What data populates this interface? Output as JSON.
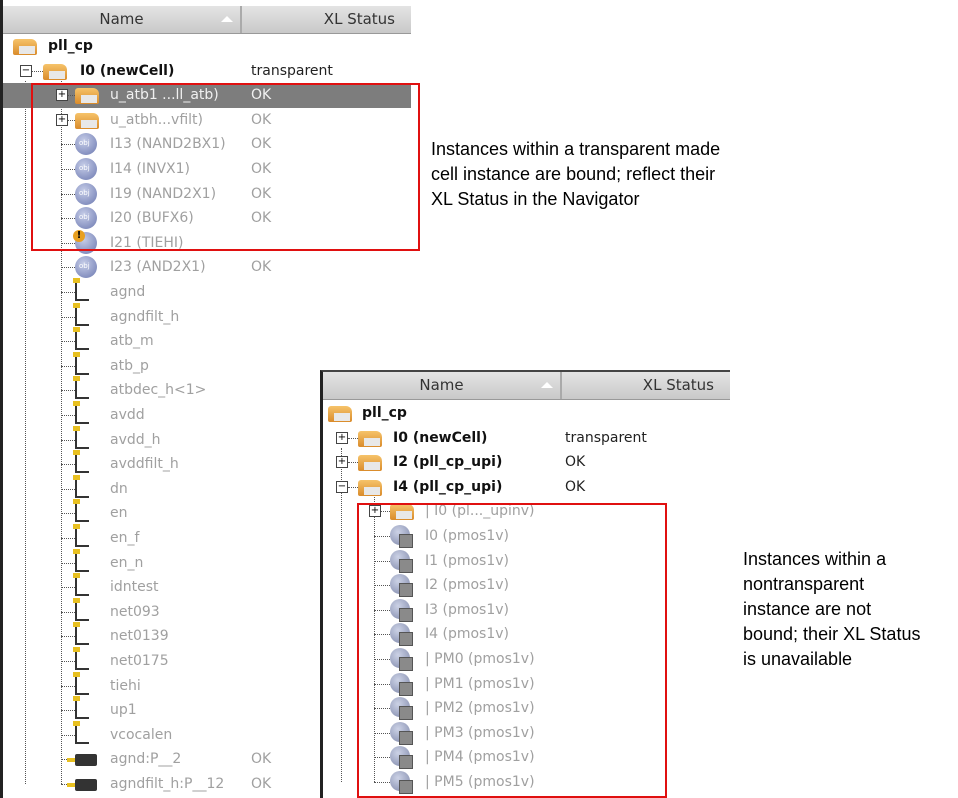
{
  "columns": {
    "name": "Name",
    "status": "XL Status"
  },
  "navigator_left": {
    "rows": [
      {
        "label": "pll_cp",
        "status": "",
        "level": 0,
        "icon": "folder",
        "style": "bold"
      },
      {
        "label": "I0 (newCell)",
        "status": "transparent",
        "level": 1,
        "icon": "folder",
        "style": "bold",
        "expander": "minus"
      },
      {
        "label": "u_atb1 ...ll_atb)",
        "status": "OK",
        "level": 2,
        "icon": "folder",
        "style": "gray",
        "expander": "plus",
        "selected": true
      },
      {
        "label": "u_atbh...vfilt)",
        "status": "OK",
        "level": 2,
        "icon": "folder",
        "style": "gray",
        "expander": "plus"
      },
      {
        "label": "I13 (NAND2BX1)",
        "status": "OK",
        "level": 2,
        "icon": "obj",
        "style": "gray"
      },
      {
        "label": "I14 (INVX1)",
        "status": "OK",
        "level": 2,
        "icon": "obj",
        "style": "gray"
      },
      {
        "label": "I19 (NAND2X1)",
        "status": "OK",
        "level": 2,
        "icon": "obj",
        "style": "gray"
      },
      {
        "label": "I20 (BUFX6)",
        "status": "OK",
        "level": 2,
        "icon": "obj",
        "style": "gray"
      },
      {
        "label": "I21 (TIEHI)",
        "status": "",
        "level": 2,
        "icon": "warn",
        "style": "gray"
      },
      {
        "label": "I23 (AND2X1)",
        "status": "OK",
        "level": 2,
        "icon": "obj",
        "style": "gray"
      },
      {
        "label": "agnd",
        "status": "",
        "level": 2,
        "icon": "net",
        "style": "gray"
      },
      {
        "label": "agndfilt_h",
        "status": "",
        "level": 2,
        "icon": "net",
        "style": "gray"
      },
      {
        "label": "atb_m",
        "status": "",
        "level": 2,
        "icon": "net",
        "style": "gray"
      },
      {
        "label": "atb_p",
        "status": "",
        "level": 2,
        "icon": "net",
        "style": "gray"
      },
      {
        "label": "atbdec_h<1>",
        "status": "",
        "level": 2,
        "icon": "net",
        "style": "gray"
      },
      {
        "label": "avdd",
        "status": "",
        "level": 2,
        "icon": "net",
        "style": "gray"
      },
      {
        "label": "avdd_h",
        "status": "",
        "level": 2,
        "icon": "net",
        "style": "gray"
      },
      {
        "label": "avddfilt_h",
        "status": "",
        "level": 2,
        "icon": "net",
        "style": "gray"
      },
      {
        "label": "dn",
        "status": "",
        "level": 2,
        "icon": "net",
        "style": "gray"
      },
      {
        "label": "en",
        "status": "",
        "level": 2,
        "icon": "net",
        "style": "gray"
      },
      {
        "label": "en_f",
        "status": "",
        "level": 2,
        "icon": "net",
        "style": "gray"
      },
      {
        "label": "en_n",
        "status": "",
        "level": 2,
        "icon": "net",
        "style": "gray"
      },
      {
        "label": "idntest",
        "status": "",
        "level": 2,
        "icon": "net",
        "style": "gray"
      },
      {
        "label": "net093",
        "status": "",
        "level": 2,
        "icon": "net",
        "style": "gray"
      },
      {
        "label": "net0139",
        "status": "",
        "level": 2,
        "icon": "net",
        "style": "gray"
      },
      {
        "label": "net0175",
        "status": "",
        "level": 2,
        "icon": "net",
        "style": "gray"
      },
      {
        "label": "tiehi",
        "status": "",
        "level": 2,
        "icon": "net",
        "style": "gray"
      },
      {
        "label": "up1",
        "status": "",
        "level": 2,
        "icon": "net",
        "style": "gray"
      },
      {
        "label": "vcocalen",
        "status": "",
        "level": 2,
        "icon": "net",
        "style": "gray"
      },
      {
        "label": "agnd:P__2",
        "status": "OK",
        "level": 2,
        "icon": "pin",
        "style": "gray"
      },
      {
        "label": "agndfilt_h:P__12",
        "status": "OK",
        "level": 2,
        "icon": "pin",
        "style": "gray"
      }
    ]
  },
  "navigator_right": {
    "rows": [
      {
        "label": "pll_cp",
        "status": "",
        "level": 0,
        "icon": "folder",
        "style": "bold"
      },
      {
        "label": "I0 (newCell)",
        "status": "transparent",
        "level": 1,
        "icon": "folder",
        "style": "bold",
        "expander": "plus"
      },
      {
        "label": "I2 (pll_cp_upi)",
        "status": "OK",
        "level": 1,
        "icon": "folder",
        "style": "bold",
        "expander": "plus"
      },
      {
        "label": "I4 (pll_cp_upi)",
        "status": "OK",
        "level": 1,
        "icon": "folder",
        "style": "bold",
        "expander": "minus"
      },
      {
        "label": "| I0 (pl..._upinv)",
        "status": "",
        "level": 2,
        "icon": "folder",
        "style": "gray",
        "expander": "plus"
      },
      {
        "label": "I0 (pmos1v)",
        "status": "",
        "level": 2,
        "icon": "dev",
        "style": "gray"
      },
      {
        "label": "I1 (pmos1v)",
        "status": "",
        "level": 2,
        "icon": "dev",
        "style": "gray"
      },
      {
        "label": "I2 (pmos1v)",
        "status": "",
        "level": 2,
        "icon": "dev",
        "style": "gray"
      },
      {
        "label": "I3 (pmos1v)",
        "status": "",
        "level": 2,
        "icon": "dev",
        "style": "gray"
      },
      {
        "label": "I4 (pmos1v)",
        "status": "",
        "level": 2,
        "icon": "dev",
        "style": "gray"
      },
      {
        "label": "| PM0 (pmos1v)",
        "status": "",
        "level": 2,
        "icon": "dev",
        "style": "gray"
      },
      {
        "label": "| PM1 (pmos1v)",
        "status": "",
        "level": 2,
        "icon": "dev",
        "style": "gray"
      },
      {
        "label": "| PM2 (pmos1v)",
        "status": "",
        "level": 2,
        "icon": "dev",
        "style": "gray"
      },
      {
        "label": "| PM3 (pmos1v)",
        "status": "",
        "level": 2,
        "icon": "dev",
        "style": "gray"
      },
      {
        "label": "| PM4 (pmos1v)",
        "status": "",
        "level": 2,
        "icon": "dev",
        "style": "gray"
      },
      {
        "label": "| PM5 (pmos1v)",
        "status": "",
        "level": 2,
        "icon": "dev",
        "style": "gray"
      }
    ]
  },
  "annotations": {
    "transparent": "Instances within a transparent made cell instance are bound; reflect their XL Status in the Navigator",
    "nontransparent": "Instances within a nontransparent instance are not bound; their XL Status is unavailable"
  }
}
